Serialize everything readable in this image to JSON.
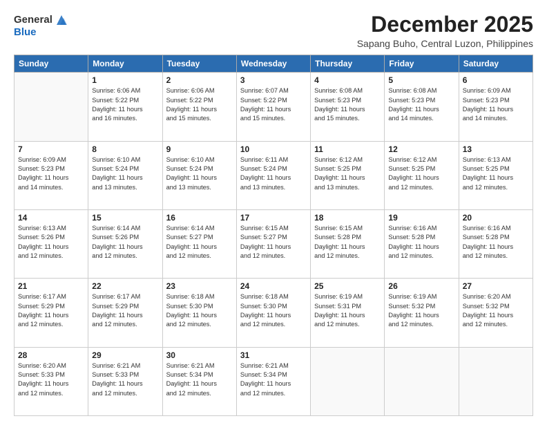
{
  "header": {
    "logo_line1": "General",
    "logo_line2": "Blue",
    "month": "December 2025",
    "location": "Sapang Buho, Central Luzon, Philippines"
  },
  "weekdays": [
    "Sunday",
    "Monday",
    "Tuesday",
    "Wednesday",
    "Thursday",
    "Friday",
    "Saturday"
  ],
  "weeks": [
    [
      {
        "day": "",
        "info": ""
      },
      {
        "day": "1",
        "info": "Sunrise: 6:06 AM\nSunset: 5:22 PM\nDaylight: 11 hours\nand 16 minutes."
      },
      {
        "day": "2",
        "info": "Sunrise: 6:06 AM\nSunset: 5:22 PM\nDaylight: 11 hours\nand 15 minutes."
      },
      {
        "day": "3",
        "info": "Sunrise: 6:07 AM\nSunset: 5:22 PM\nDaylight: 11 hours\nand 15 minutes."
      },
      {
        "day": "4",
        "info": "Sunrise: 6:08 AM\nSunset: 5:23 PM\nDaylight: 11 hours\nand 15 minutes."
      },
      {
        "day": "5",
        "info": "Sunrise: 6:08 AM\nSunset: 5:23 PM\nDaylight: 11 hours\nand 14 minutes."
      },
      {
        "day": "6",
        "info": "Sunrise: 6:09 AM\nSunset: 5:23 PM\nDaylight: 11 hours\nand 14 minutes."
      }
    ],
    [
      {
        "day": "7",
        "info": "Sunrise: 6:09 AM\nSunset: 5:23 PM\nDaylight: 11 hours\nand 14 minutes."
      },
      {
        "day": "8",
        "info": "Sunrise: 6:10 AM\nSunset: 5:24 PM\nDaylight: 11 hours\nand 13 minutes."
      },
      {
        "day": "9",
        "info": "Sunrise: 6:10 AM\nSunset: 5:24 PM\nDaylight: 11 hours\nand 13 minutes."
      },
      {
        "day": "10",
        "info": "Sunrise: 6:11 AM\nSunset: 5:24 PM\nDaylight: 11 hours\nand 13 minutes."
      },
      {
        "day": "11",
        "info": "Sunrise: 6:12 AM\nSunset: 5:25 PM\nDaylight: 11 hours\nand 13 minutes."
      },
      {
        "day": "12",
        "info": "Sunrise: 6:12 AM\nSunset: 5:25 PM\nDaylight: 11 hours\nand 12 minutes."
      },
      {
        "day": "13",
        "info": "Sunrise: 6:13 AM\nSunset: 5:25 PM\nDaylight: 11 hours\nand 12 minutes."
      }
    ],
    [
      {
        "day": "14",
        "info": "Sunrise: 6:13 AM\nSunset: 5:26 PM\nDaylight: 11 hours\nand 12 minutes."
      },
      {
        "day": "15",
        "info": "Sunrise: 6:14 AM\nSunset: 5:26 PM\nDaylight: 11 hours\nand 12 minutes."
      },
      {
        "day": "16",
        "info": "Sunrise: 6:14 AM\nSunset: 5:27 PM\nDaylight: 11 hours\nand 12 minutes."
      },
      {
        "day": "17",
        "info": "Sunrise: 6:15 AM\nSunset: 5:27 PM\nDaylight: 11 hours\nand 12 minutes."
      },
      {
        "day": "18",
        "info": "Sunrise: 6:15 AM\nSunset: 5:28 PM\nDaylight: 11 hours\nand 12 minutes."
      },
      {
        "day": "19",
        "info": "Sunrise: 6:16 AM\nSunset: 5:28 PM\nDaylight: 11 hours\nand 12 minutes."
      },
      {
        "day": "20",
        "info": "Sunrise: 6:16 AM\nSunset: 5:28 PM\nDaylight: 11 hours\nand 12 minutes."
      }
    ],
    [
      {
        "day": "21",
        "info": "Sunrise: 6:17 AM\nSunset: 5:29 PM\nDaylight: 11 hours\nand 12 minutes."
      },
      {
        "day": "22",
        "info": "Sunrise: 6:17 AM\nSunset: 5:29 PM\nDaylight: 11 hours\nand 12 minutes."
      },
      {
        "day": "23",
        "info": "Sunrise: 6:18 AM\nSunset: 5:30 PM\nDaylight: 11 hours\nand 12 minutes."
      },
      {
        "day": "24",
        "info": "Sunrise: 6:18 AM\nSunset: 5:30 PM\nDaylight: 11 hours\nand 12 minutes."
      },
      {
        "day": "25",
        "info": "Sunrise: 6:19 AM\nSunset: 5:31 PM\nDaylight: 11 hours\nand 12 minutes."
      },
      {
        "day": "26",
        "info": "Sunrise: 6:19 AM\nSunset: 5:32 PM\nDaylight: 11 hours\nand 12 minutes."
      },
      {
        "day": "27",
        "info": "Sunrise: 6:20 AM\nSunset: 5:32 PM\nDaylight: 11 hours\nand 12 minutes."
      }
    ],
    [
      {
        "day": "28",
        "info": "Sunrise: 6:20 AM\nSunset: 5:33 PM\nDaylight: 11 hours\nand 12 minutes."
      },
      {
        "day": "29",
        "info": "Sunrise: 6:21 AM\nSunset: 5:33 PM\nDaylight: 11 hours\nand 12 minutes."
      },
      {
        "day": "30",
        "info": "Sunrise: 6:21 AM\nSunset: 5:34 PM\nDaylight: 11 hours\nand 12 minutes."
      },
      {
        "day": "31",
        "info": "Sunrise: 6:21 AM\nSunset: 5:34 PM\nDaylight: 11 hours\nand 12 minutes."
      },
      {
        "day": "",
        "info": ""
      },
      {
        "day": "",
        "info": ""
      },
      {
        "day": "",
        "info": ""
      }
    ]
  ]
}
